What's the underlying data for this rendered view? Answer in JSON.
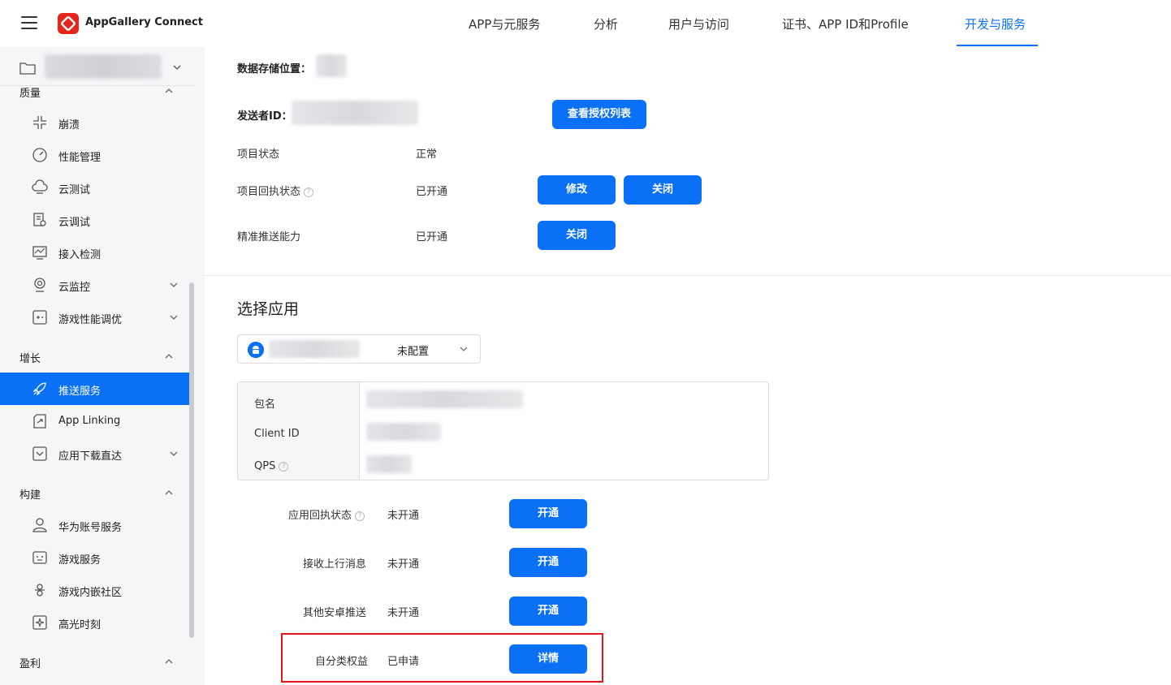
{
  "header": {
    "brand": "AppGallery Connect",
    "nav": [
      {
        "label": "APP与元服务"
      },
      {
        "label": "分析"
      },
      {
        "label": "用户与访问"
      },
      {
        "label": "证书、APP ID和Profile"
      },
      {
        "label": "开发与服务"
      }
    ],
    "active_tab": "开发与服务"
  },
  "sidebar": {
    "sections": {
      "quality": "质量",
      "growth": "增长",
      "build": "构建",
      "profit": "盈利"
    },
    "items": [
      {
        "label": "崩溃"
      },
      {
        "label": "性能管理"
      },
      {
        "label": "云测试"
      },
      {
        "label": "云调试"
      },
      {
        "label": "接入检测"
      },
      {
        "label": "云监控"
      },
      {
        "label": "游戏性能调优"
      },
      {
        "label": "推送服务"
      },
      {
        "label": "App Linking"
      },
      {
        "label": "应用下载直达"
      },
      {
        "label": "华为账号服务"
      },
      {
        "label": "游戏服务"
      },
      {
        "label": "游戏内嵌社区"
      },
      {
        "label": "高光时刻"
      }
    ],
    "active_item": "推送服务"
  },
  "project": {
    "storage_label": "数据存储位置：",
    "sender_label": "发送者ID：",
    "view_auth_btn": "查看授权列表",
    "status_label": "项目状态",
    "status_value": "正常",
    "receipt_label": "项目回执状态",
    "receipt_value": "已开通",
    "modify_btn": "修改",
    "close_btn": "关闭",
    "precise_label": "精准推送能力",
    "precise_value": "已开通",
    "precise_close_btn": "关闭"
  },
  "app": {
    "section_title": "选择应用",
    "selected_status": "未配置",
    "info_keys": {
      "package": "包名",
      "client_id": "Client ID",
      "qps": "QPS"
    },
    "rows": [
      {
        "label": "应用回执状态",
        "value": "未开通",
        "button": "开通"
      },
      {
        "label": "接收上行消息",
        "value": "未开通",
        "button": "开通"
      },
      {
        "label": "其他安卓推送",
        "value": "未开通",
        "button": "开通"
      },
      {
        "label": "自分类权益",
        "value": "已申请",
        "button": "详情"
      }
    ]
  },
  "colors": {
    "accent": "#0a70f5",
    "highlight": "#e4161c"
  }
}
